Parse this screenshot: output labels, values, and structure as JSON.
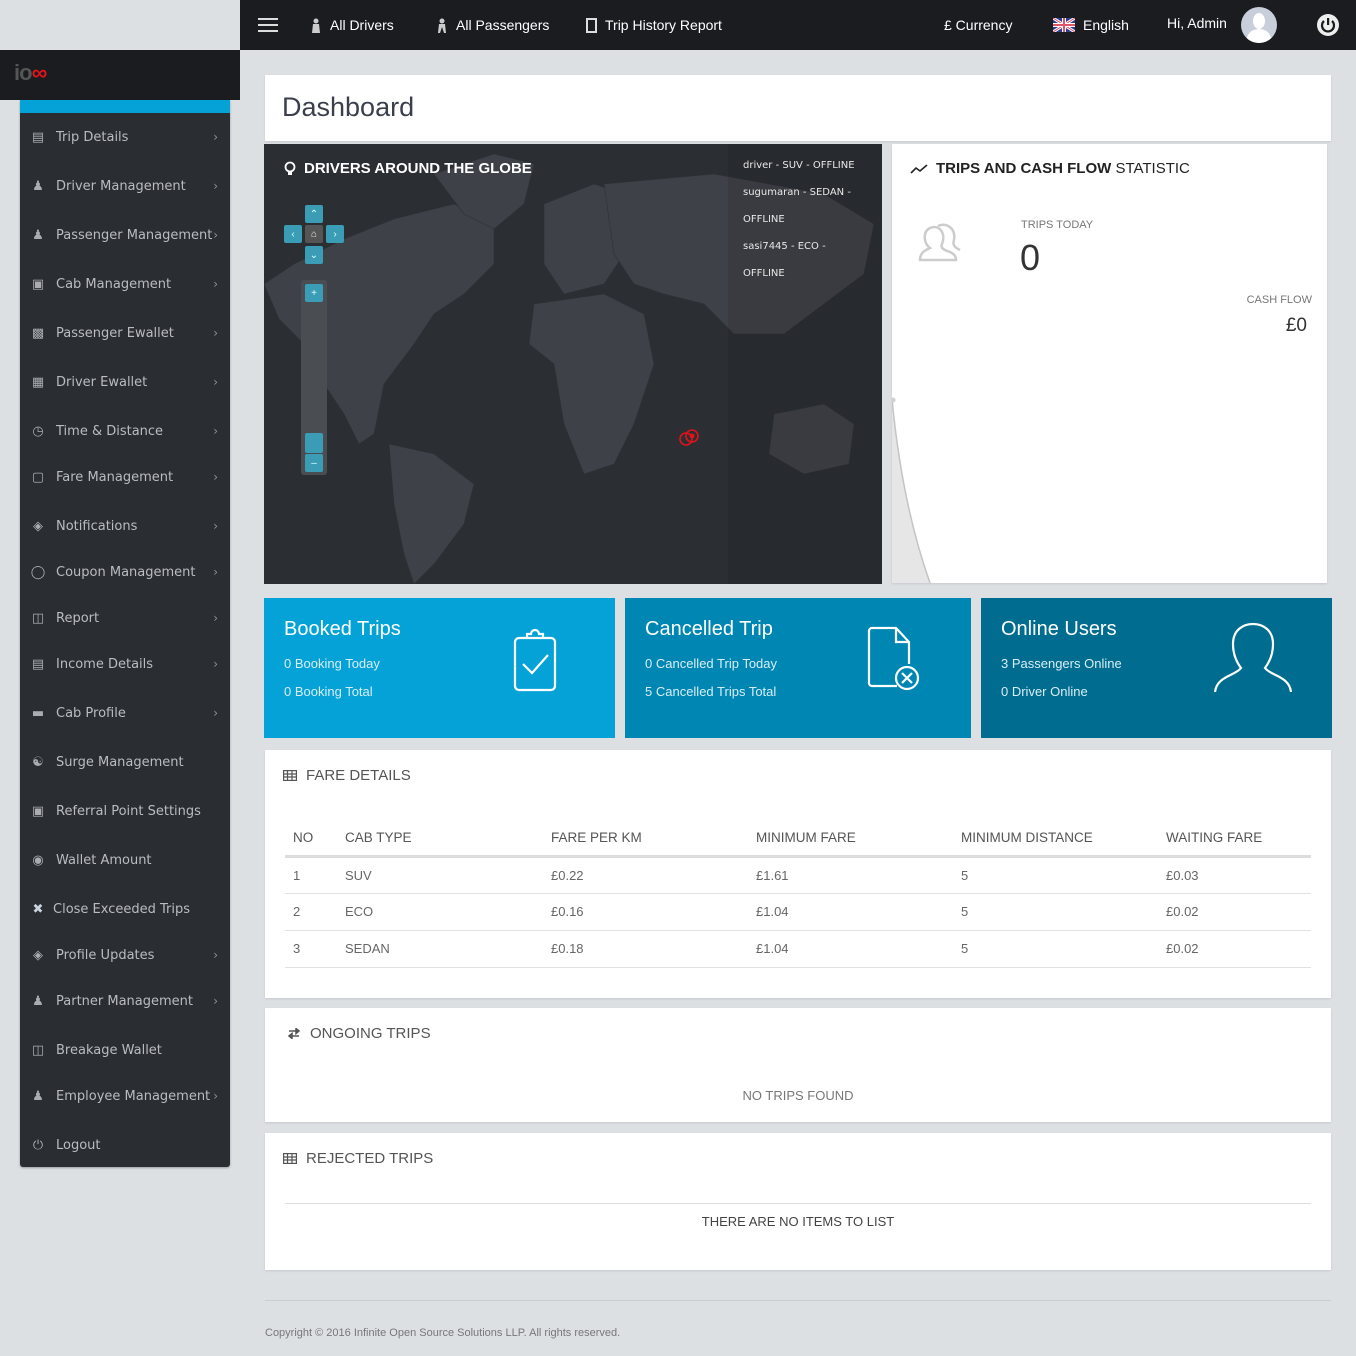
{
  "topbar": {
    "menu_icon": "hamburger-icon",
    "links": [
      {
        "label": "All Drivers",
        "icon": "driver-icon"
      },
      {
        "label": "All Passengers",
        "icon": "passenger-icon"
      },
      {
        "label": "Trip History Report",
        "icon": "notebook-icon"
      }
    ],
    "currency": "£ Currency",
    "language": "English",
    "greeting": "Hi, Admin"
  },
  "brand": {
    "logo_text_a": "io",
    "logo_text_b": "∞"
  },
  "sidebar": {
    "items": [
      {
        "label": "Trip Details",
        "icon": "trip-icon",
        "chevron": true
      },
      {
        "label": "Driver Management",
        "icon": "driver-icon",
        "chevron": true
      },
      {
        "label": "Passenger Management",
        "icon": "passenger-icon",
        "chevron": true
      },
      {
        "label": "Cab Management",
        "icon": "car-icon",
        "chevron": true
      },
      {
        "label": "Passenger Ewallet",
        "icon": "money-icon",
        "chevron": true
      },
      {
        "label": "Driver Ewallet",
        "icon": "wallet-icon",
        "chevron": true
      },
      {
        "label": "Time & Distance",
        "icon": "gauge-icon",
        "chevron": true
      },
      {
        "label": "Fare Management",
        "icon": "briefcase-icon",
        "chevron": true
      },
      {
        "label": "Notifications",
        "icon": "layers-icon",
        "chevron": true
      },
      {
        "label": "Coupon Management",
        "icon": "cart-icon",
        "chevron": true
      },
      {
        "label": "Report",
        "icon": "copy-icon",
        "chevron": true
      },
      {
        "label": "Income Details",
        "icon": "cards-icon",
        "chevron": true
      },
      {
        "label": "Cab Profile",
        "icon": "cab-icon",
        "chevron": true
      },
      {
        "label": "Surge Management",
        "icon": "group-icon",
        "chevron": false
      },
      {
        "label": "Referral Point Settings",
        "icon": "save-icon",
        "chevron": false
      },
      {
        "label": "Wallet Amount",
        "icon": "eye-icon",
        "chevron": false
      },
      {
        "label": "Close Exceeded Trips",
        "icon": "close-icon",
        "chevron": false
      },
      {
        "label": "Profile Updates",
        "icon": "layers-icon",
        "chevron": true
      },
      {
        "label": "Partner Management",
        "icon": "person-icon",
        "chevron": true
      },
      {
        "label": "Breakage Wallet",
        "icon": "copy-icon",
        "chevron": false
      },
      {
        "label": "Employee Management",
        "icon": "person-icon",
        "chevron": true
      },
      {
        "label": "Logout",
        "icon": "power-icon",
        "chevron": false
      }
    ]
  },
  "page": {
    "title": "Dashboard"
  },
  "map": {
    "title": "DRIVERS AROUND THE GLOBE",
    "drivers": [
      "driver - SUV - OFFLINE",
      "sugumaran - SEDAN -",
      "OFFLINE",
      "sasi7445 - ECO -",
      "OFFLINE"
    ],
    "marker_color": "#e2121a"
  },
  "stats": {
    "title_bold": "TRIPS AND CASH FLOW",
    "title_rest": " STATISTIC",
    "trips_today_label": "TRIPS TODAY",
    "trips_today_value": "0",
    "cash_flow_label": "CASH FLOW",
    "cash_flow_value": "£0"
  },
  "tiles": [
    {
      "title": "Booked Trips",
      "line1": "0 Booking Today",
      "line2": "0 Booking Total",
      "color": "#04a2d6"
    },
    {
      "title": "Cancelled Trip",
      "line1": "0 Cancelled Trip Today",
      "line2": "5 Cancelled Trips Total",
      "color": "#0086b3"
    },
    {
      "title": "Online Users",
      "line1": "3 Passengers Online",
      "line2": "0 Driver Online",
      "color": "#006c8f"
    }
  ],
  "fare": {
    "title": "FARE DETAILS",
    "columns": [
      "NO",
      "CAB TYPE",
      "FARE PER KM",
      "MINIMUM FARE",
      "MINIMUM DISTANCE",
      "WAITING FARE"
    ],
    "rows": [
      [
        "1",
        "SUV",
        "£0.22",
        "£1.61",
        "5",
        "£0.03"
      ],
      [
        "2",
        "ECO",
        "£0.16",
        "£1.04",
        "5",
        "£0.02"
      ],
      [
        "3",
        "SEDAN",
        "£0.18",
        "£1.04",
        "5",
        "£0.02"
      ]
    ]
  },
  "ongoing": {
    "title": "ONGOING TRIPS",
    "empty": "NO TRIPS FOUND"
  },
  "rejected": {
    "title": "REJECTED TRIPS",
    "empty": "THERE ARE NO ITEMS TO LIST"
  },
  "footer": {
    "copyright": "Copyright © 2016 Infinite Open Source Solutions LLP. All rights reserved."
  }
}
